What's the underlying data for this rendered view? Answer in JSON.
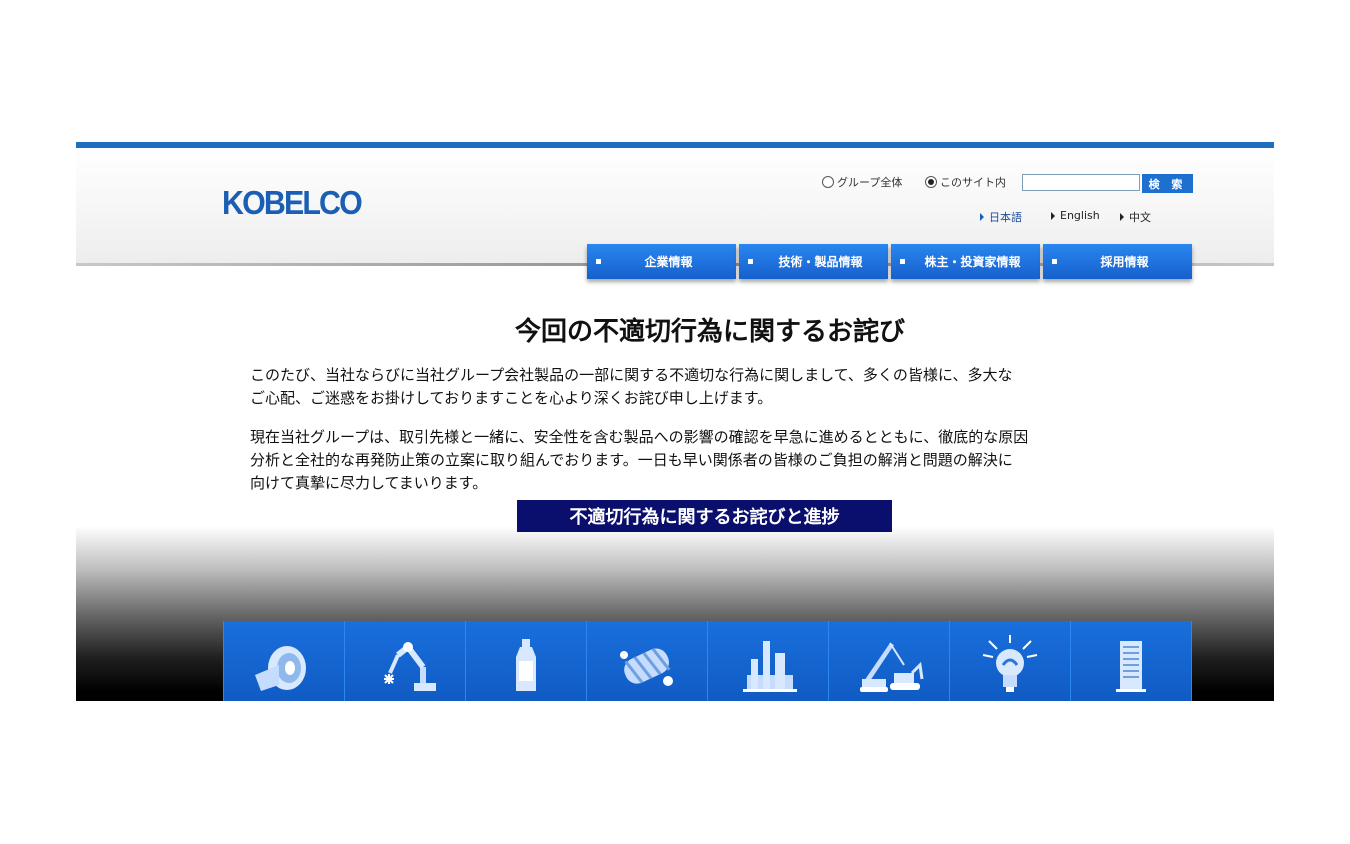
{
  "header": {
    "logo_text": "KOBELCO",
    "search": {
      "scope_all_label": "グループ全体",
      "scope_site_label": "このサイト内",
      "selected_scope": "このサイト内",
      "input_value": "",
      "button_label": "検 索"
    },
    "languages": [
      {
        "label": "日本語",
        "active": true
      },
      {
        "label": "English",
        "active": false
      },
      {
        "label": "中文",
        "active": false
      }
    ]
  },
  "nav": {
    "items": [
      {
        "label": "企業情報"
      },
      {
        "label": "技術・製品情報"
      },
      {
        "label": "株主・投資家情報"
      },
      {
        "label": "採用情報"
      }
    ]
  },
  "main": {
    "title": "今回の不適切行為に関するお詫び",
    "paragraph1_line1": "このたび、当社ならびに当社グループ会社製品の一部に関する不適切な行為に関しまして、多くの皆様に、多大な",
    "paragraph1_line2": "ご心配、ご迷惑をお掛けしておりますことを心より深くお詫び申し上げます。",
    "paragraph2_line1": "現在当社グループは、取引先様と一緒に、安全性を含む製品への影響の確認を早急に進めるとともに、徹底的な原因",
    "paragraph2_line2": "分析と全社的な再発防止策の立案に取り組んでおります。一日も早い関係者の皆様のご負担の解消と問題の解決に",
    "paragraph2_line3": "向けて真摯に尽力してまいります。",
    "cta_label": "不適切行為に関するお詫びと進捗"
  },
  "business_icons": [
    {
      "icon": "steel-coil-icon"
    },
    {
      "icon": "welding-robot-icon"
    },
    {
      "icon": "bottle-icon"
    },
    {
      "icon": "compressor-icon"
    },
    {
      "icon": "plant-icon"
    },
    {
      "icon": "construction-machinery-icon"
    },
    {
      "icon": "light-bulb-icon"
    },
    {
      "icon": "building-icon"
    }
  ],
  "colors": {
    "brand_blue": "#1a5fb4",
    "nav_blue": "#1d6fd0",
    "cta_navy": "#0a0f6e"
  }
}
